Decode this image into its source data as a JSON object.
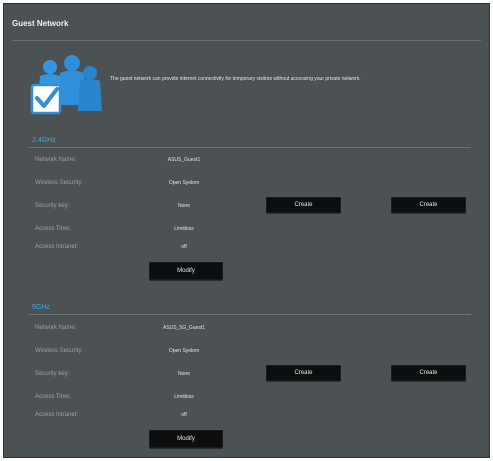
{
  "page": {
    "title": "Guest Network",
    "intro": "The guest network can provide internet connectivity for temporary visitors without accessing your private network."
  },
  "bands": [
    {
      "label": "2.4GHz",
      "fields": [
        {
          "label": "Network Name:",
          "value": "ASUS_Guest1"
        },
        {
          "label": "Wireless Security:",
          "value": "Open System"
        },
        {
          "label": "Security key:",
          "value": "None"
        },
        {
          "label": "Access Time:",
          "value": "Limitless"
        },
        {
          "label": "Access Intranet:",
          "value": "off"
        }
      ],
      "create_buttons": [
        "Create",
        "Create"
      ],
      "modify_label": "Modify"
    },
    {
      "label": "5GHz",
      "fields": [
        {
          "label": "Network Name:",
          "value": "ASUS_5G_Guest1"
        },
        {
          "label": "Wireless Security:",
          "value": "Open System"
        },
        {
          "label": "Security key:",
          "value": "None"
        },
        {
          "label": "Access Time:",
          "value": "Limitless"
        },
        {
          "label": "Access Intranet:",
          "value": "off"
        }
      ],
      "create_buttons": [
        "Create",
        "Create"
      ],
      "modify_label": "Modify"
    }
  ],
  "colors": {
    "background": "#4c5254",
    "band_label": "#3aa7e0",
    "button": "#0b0d0e",
    "logo_blue": "#2f8fd8"
  },
  "icons": [
    "guest-users-checkmark-icon"
  ]
}
